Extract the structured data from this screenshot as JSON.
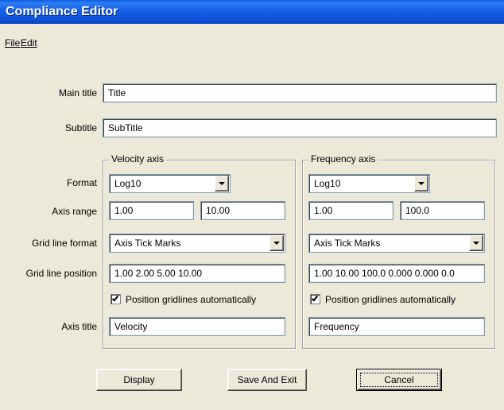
{
  "window": {
    "title": "Compliance Editor"
  },
  "menu": {
    "file": "File",
    "edit": "Edit"
  },
  "main_title": {
    "label": "Main title",
    "value": "Title"
  },
  "subtitle": {
    "label": "Subtitle",
    "value": "SubTitle"
  },
  "row_labels": {
    "format": "Format",
    "axis_range": "Axis range",
    "grid_line_format": "Grid line format",
    "grid_line_position": "Grid line position",
    "axis_title": "Axis title"
  },
  "velocity_axis": {
    "legend": "Velocity axis",
    "format": "Log10",
    "range_min": "1.00",
    "range_max": "10.00",
    "grid_format": "Axis Tick Marks",
    "grid_position": "1.00  2.00  5.00 10.00",
    "auto_label": "Position gridlines automatically",
    "auto_checked": true,
    "axis_title": "Velocity"
  },
  "frequency_axis": {
    "legend": "Frequency axis",
    "format": "Log10",
    "range_min": "1.00",
    "range_max": "100.0",
    "grid_format": "Axis Tick Marks",
    "grid_position": "1.00 10.00  100.0 0.000 0.000 0.0",
    "auto_label": "Position gridlines automatically",
    "auto_checked": true,
    "axis_title": "Frequency"
  },
  "buttons": {
    "display": "Display",
    "save_exit": "Save And Exit",
    "cancel": "Cancel"
  }
}
